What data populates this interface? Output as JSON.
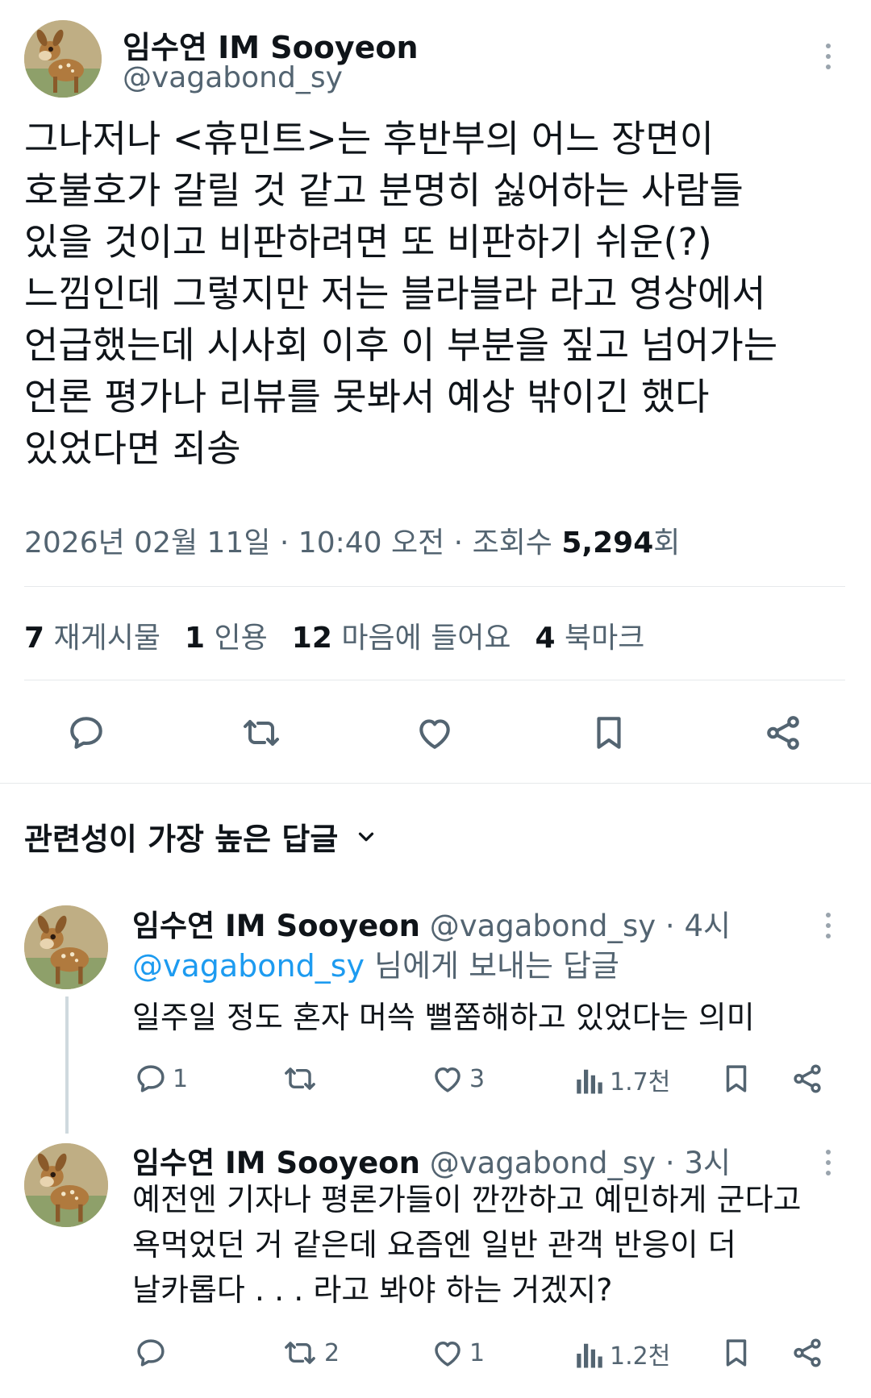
{
  "tweet": {
    "author_name": "임수연 IM Sooyeon",
    "author_handle": "@vagabond_sy",
    "lines": [
      "그나저나 <휴민트>는 후반부의 어느 장면이",
      "호불호가 갈릴 것 같고 분명히 싫어하는 사람들",
      "있을 것이고 비판하려면 또 비판하기 쉬운(?)",
      "느낌인데 그렇지만 저는 블라블라 라고 영상에서",
      "언급했는데 시사회 이후 이 부분을 짚고 넘어가는",
      "언론 평가나 리뷰를 못봐서 예상 밖이긴 했다",
      "있었다면 죄송"
    ],
    "meta_prefix": "2026년 02월 11일 · 10:40 오전 · 조회수 ",
    "views": "5,294",
    "views_suffix": "회",
    "stats": [
      {
        "count": "7",
        "label": "재게시물"
      },
      {
        "count": "1",
        "label": "인용"
      },
      {
        "count": "12",
        "label": "마음에 들어요"
      },
      {
        "count": "4",
        "label": "북마크"
      }
    ]
  },
  "actions_icons": [
    "reply-icon",
    "repost-icon",
    "like-icon",
    "bookmark-icon",
    "share-icon"
  ],
  "replies_header": {
    "label": "관련성이 가장 높은 답글"
  },
  "replies": [
    {
      "author_name": "임수연 IM Sooyeon",
      "author_handle": "@vagabond_sy",
      "time": " · 4시",
      "replying_to_handle": "@vagabond_sy",
      "replying_to_suffix": " 님에게 보내는 답글",
      "lines": [
        "일주일 정도 혼자 머쓱 뻘쭘해하고 있었다는 의미"
      ],
      "reply_count": "1",
      "repost_count": "",
      "like_count": "3",
      "view_count": "1.7천"
    },
    {
      "author_name": "임수연 IM Sooyeon",
      "author_handle": "@vagabond_sy",
      "time": " · 3시",
      "lines": [
        "예전엔 기자나 평론가들이 깐깐하고 예민하게 군다고",
        "욕먹었던 거 같은데 요즘엔 일반 관객 반응이 더",
        "날카롭다 . . . 라고 봐야 하는 거겠지?"
      ],
      "reply_count": "",
      "repost_count": "2",
      "like_count": "1",
      "view_count": "1.2천"
    }
  ],
  "colors": {
    "text": "#0f1419",
    "muted": "#536471",
    "link": "#1d9bf0",
    "divider": "#e6e9eb"
  }
}
